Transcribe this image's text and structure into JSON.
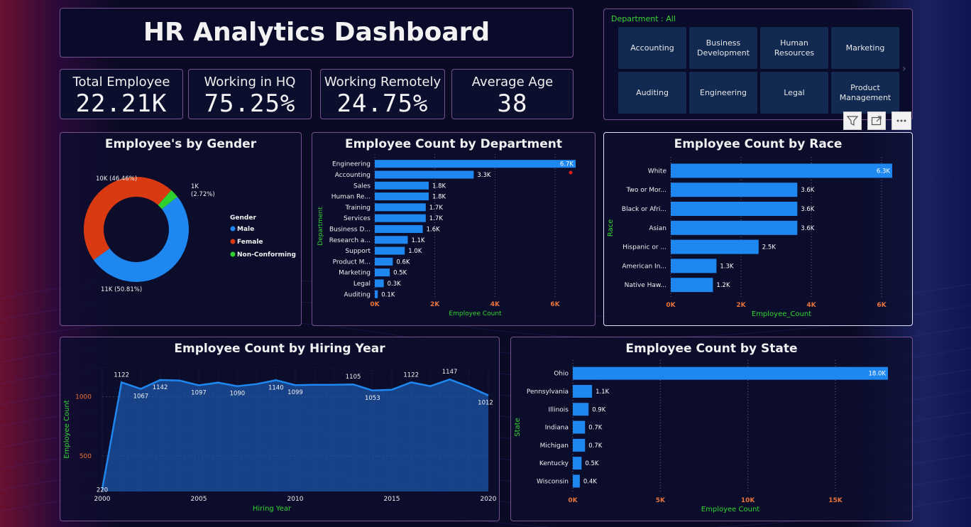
{
  "header": {
    "title": "HR Analytics Dashboard"
  },
  "kpis": [
    {
      "label": "Total Employee",
      "value": "22.21K"
    },
    {
      "label": "Working in HQ",
      "value": "75.25%"
    },
    {
      "label": "Working Remotely",
      "value": "24.75%"
    },
    {
      "label": "Average Age",
      "value": "38"
    }
  ],
  "slicer": {
    "title": "Department : All",
    "items": [
      "Accounting",
      "Business Development",
      "Human Resources",
      "Marketing",
      "Auditing",
      "Engineering",
      "Legal",
      "Product Management"
    ],
    "next_icon": "chevron-right-icon"
  },
  "toolbar": {
    "icons": [
      "filter-icon",
      "focus-mode-icon",
      "more-options-icon"
    ]
  },
  "chart_data": [
    {
      "type": "pie",
      "title": "Employee's by Gender",
      "legend_title": "Gender",
      "legend_position": "right",
      "categories": [
        "Male",
        "Female",
        "Non-Conforming"
      ],
      "values": [
        50.81,
        46.46,
        2.72
      ],
      "labels": [
        "11K (50.81%)",
        "10K (46.46%)",
        "1K (2.72%)"
      ],
      "colors": [
        "#1e88f0",
        "#d93a12",
        "#2fd12f"
      ]
    },
    {
      "type": "bar",
      "orientation": "horizontal",
      "title": "Employee Count by Department",
      "xlabel": "Employee Count",
      "ylabel": "Department",
      "categories": [
        "Engineering",
        "Accounting",
        "Sales",
        "Human Re...",
        "Training",
        "Services",
        "Business D...",
        "Research a...",
        "Support",
        "Product M...",
        "Marketing",
        "Legal",
        "Auditing"
      ],
      "values": [
        6.7,
        3.3,
        1.8,
        1.8,
        1.7,
        1.7,
        1.6,
        1.1,
        1.0,
        0.6,
        0.5,
        0.3,
        0.1
      ],
      "data_labels": [
        "6.7K",
        "3.3K",
        "1.8K",
        "1.8K",
        "1.7K",
        "1.7K",
        "1.6K",
        "1.1K",
        "1.0K",
        "0.6K",
        "0.5K",
        "0.3K",
        "0.1K"
      ],
      "xticks": [
        "0K",
        "2K",
        "4K",
        "6K"
      ],
      "xlim": [
        0,
        6.7
      ],
      "color": "#1e88f0"
    },
    {
      "type": "bar",
      "orientation": "horizontal",
      "title": "Employee Count by Race",
      "xlabel": "Employee_Count",
      "ylabel": "Race",
      "categories": [
        "White",
        "Two or Mor...",
        "Black or Afri...",
        "Asian",
        "Hispanic or ...",
        "American In...",
        "Native Haw..."
      ],
      "values": [
        6.3,
        3.6,
        3.6,
        3.6,
        2.5,
        1.3,
        1.2
      ],
      "data_labels": [
        "6.3K",
        "3.6K",
        "3.6K",
        "3.6K",
        "2.5K",
        "1.3K",
        "1.2K"
      ],
      "xticks": [
        "0K",
        "2K",
        "4K",
        "6K"
      ],
      "xlim": [
        0,
        6.3
      ],
      "color": "#1e88f0"
    },
    {
      "type": "area",
      "title": "Employee Count by Hiring Year",
      "xlabel": "Hiring Year",
      "ylabel": "Employee Count",
      "x": [
        2000,
        2001,
        2002,
        2003,
        2004,
        2005,
        2006,
        2007,
        2008,
        2009,
        2010,
        2011,
        2012,
        2013,
        2014,
        2015,
        2016,
        2017,
        2018,
        2019,
        2020
      ],
      "y": [
        220,
        1122,
        1067,
        1142,
        1138,
        1097,
        1120,
        1090,
        1108,
        1140,
        1099,
        1102,
        1102,
        1105,
        1053,
        1060,
        1122,
        1090,
        1147,
        1085,
        1012
      ],
      "point_labels": [
        {
          "x": 2000,
          "text": "220"
        },
        {
          "x": 2001,
          "text": "1122"
        },
        {
          "x": 2002,
          "text": "1067"
        },
        {
          "x": 2003,
          "text": "1142"
        },
        {
          "x": 2005,
          "text": "1097"
        },
        {
          "x": 2007,
          "text": "1090"
        },
        {
          "x": 2009,
          "text": "1140"
        },
        {
          "x": 2010,
          "text": "1099"
        },
        {
          "x": 2013,
          "text": "1105"
        },
        {
          "x": 2014,
          "text": "1053"
        },
        {
          "x": 2016,
          "text": "1122"
        },
        {
          "x": 2018,
          "text": "1147"
        },
        {
          "x": 2020,
          "text": "1012"
        }
      ],
      "xticks": [
        "2000",
        "2005",
        "2010",
        "2015",
        "2020"
      ],
      "yticks": [
        "500",
        "1000"
      ],
      "ylim": [
        200,
        1250
      ],
      "color": "#1e88f0"
    },
    {
      "type": "bar",
      "orientation": "horizontal",
      "title": "Employee Count by State",
      "xlabel": "Employee Count",
      "ylabel": "State",
      "categories": [
        "Ohio",
        "Pennsylvania",
        "Illinois",
        "Indiana",
        "Michigan",
        "Kentucky",
        "Wisconsin"
      ],
      "values": [
        18.0,
        1.1,
        0.9,
        0.7,
        0.7,
        0.5,
        0.4
      ],
      "data_labels": [
        "18.0K",
        "1.1K",
        "0.9K",
        "0.7K",
        "0.7K",
        "0.5K",
        "0.4K"
      ],
      "xticks": [
        "0K",
        "5K",
        "10K",
        "15K"
      ],
      "xlim": [
        0,
        18
      ],
      "color": "#1e88f0"
    }
  ]
}
